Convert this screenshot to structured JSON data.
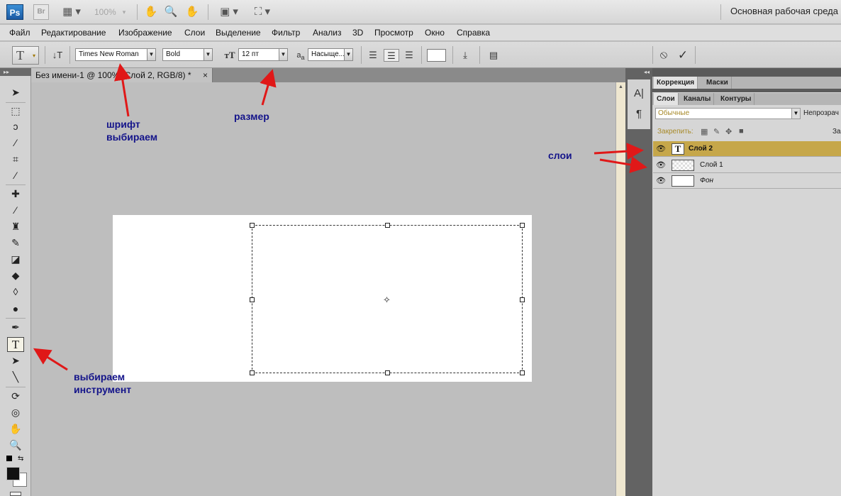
{
  "app": {
    "logo": "Ps",
    "bridge": "Br",
    "zoom": "100%",
    "workspace": "Основная рабочая среда"
  },
  "menu": [
    "Файл",
    "Редактирование",
    "Изображение",
    "Слои",
    "Выделение",
    "Фильтр",
    "Анализ",
    "3D",
    "Просмотр",
    "Окно",
    "Справка"
  ],
  "options": {
    "tool_glyph": "T",
    "font_family": "Times New Roman",
    "font_style": "Bold",
    "font_size": "12 пт",
    "antialias_label": "a",
    "antialias_sub": "a",
    "antialias": "Насыще...",
    "cancel_icon": "⦸",
    "commit_icon": "✓"
  },
  "document": {
    "tab_title": "Без имени-1 @ 100% (Слой 2, RGB/8) *",
    "close": "×"
  },
  "panels": {
    "top_tabs": [
      "Коррекция",
      "Маски"
    ],
    "layer_tabs": [
      "Слои",
      "Каналы",
      "Контуры"
    ],
    "blend_mode": "Обычные",
    "opacity_label": "Непрозрач",
    "lock_label": "Закрепить:",
    "fill_label": "За",
    "layers": [
      {
        "name": "Слой 2",
        "type": "text",
        "selected": true
      },
      {
        "name": "Слой 1",
        "type": "transparent",
        "selected": false
      },
      {
        "name": "Фон",
        "type": "background",
        "selected": false
      }
    ]
  },
  "annotations": {
    "font": [
      "шрифт",
      "выбираем"
    ],
    "size": "размер",
    "layers": "слои",
    "tool": [
      "выбираем",
      "инструмент"
    ]
  }
}
